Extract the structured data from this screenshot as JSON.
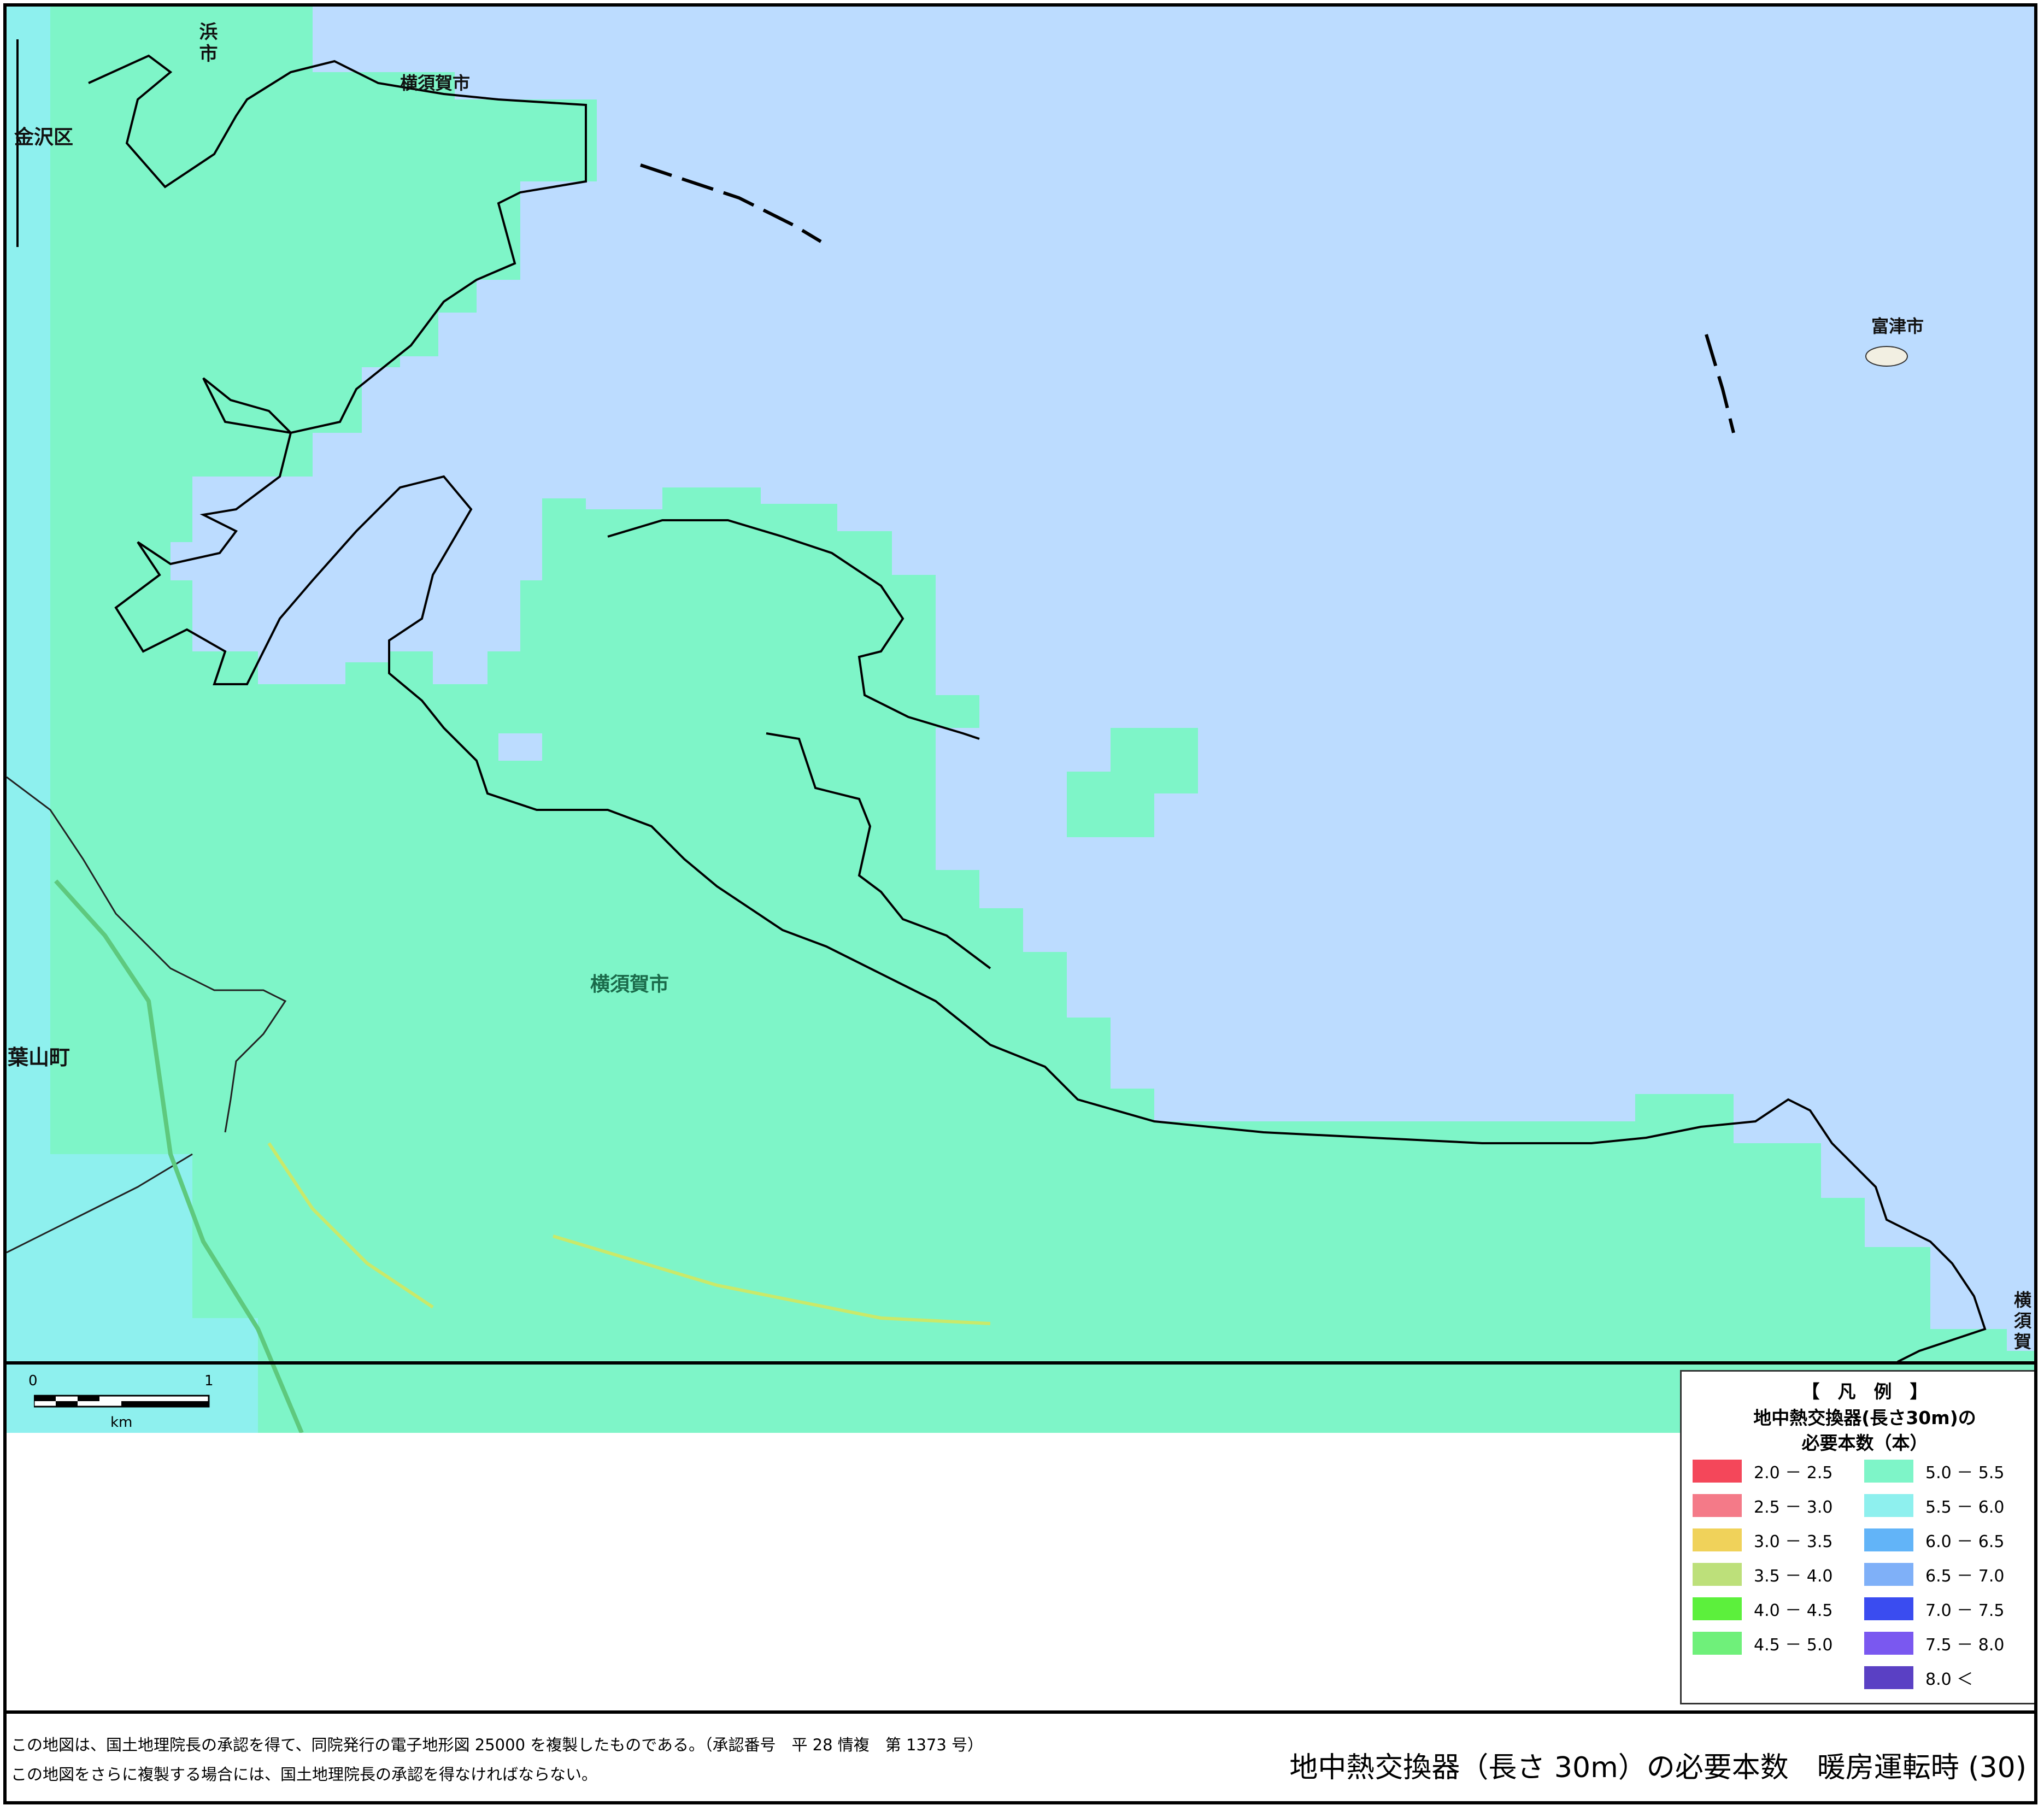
{
  "map": {
    "place_labels": {
      "top_left_city": "浜\n市",
      "kanazawa_ward": "金沢区",
      "yokosuka_top": "横須賀市",
      "futtsu_city": "富津市",
      "yokosuka_center": "横須賀市",
      "hayama_town": "葉山町",
      "yokosuka_right": "横須賀"
    },
    "colors": {
      "sea": "#bcdcff",
      "land_5_0_5_5": "#7ef5c8",
      "land_5_5_6_0": "#8ef0ee",
      "coastline": "#000000"
    }
  },
  "scale_bar": {
    "tick_start": "0",
    "tick_end": "1",
    "unit": "km"
  },
  "legend": {
    "title": "【　凡　例　】",
    "subtitle_line1": "地中熱交換器(長さ30m)の",
    "subtitle_line2": "必要本数（本）",
    "items": [
      {
        "label": "2.0 － 2.5",
        "color": "#f4475a"
      },
      {
        "label": "2.5 － 3.0",
        "color": "#f47a88"
      },
      {
        "label": "3.0 － 3.5",
        "color": "#f0d25a"
      },
      {
        "label": "3.5 － 4.0",
        "color": "#bde07a"
      },
      {
        "label": "4.0 － 4.5",
        "color": "#5cf03c"
      },
      {
        "label": "4.5 － 5.0",
        "color": "#6ff07a"
      },
      {
        "label": "5.0 － 5.5",
        "color": "#7ef5c8"
      },
      {
        "label": "5.5 － 6.0",
        "color": "#8ef0ee"
      },
      {
        "label": "6.0 － 6.5",
        "color": "#62b4f8"
      },
      {
        "label": "6.5 － 7.0",
        "color": "#7fb0f8"
      },
      {
        "label": "7.0 － 7.5",
        "color": "#3a4cf0"
      },
      {
        "label": "7.5 － 8.0",
        "color": "#7a58f0"
      },
      {
        "label": "8.0 ＜",
        "color": "#5a40c4"
      }
    ]
  },
  "footer": {
    "note_line1": "この地図は、国土地理院長の承認を得て、同院発行の電子地形図 25000 を複製したものである。（承認番号　平 28 情複　第 1373 号）",
    "note_line2": "この地図をさらに複製する場合には、国土地理院長の承認を得なければならない。",
    "map_title": "地中熱交換器（長さ 30m）の必要本数　暖房運転時 (30)"
  }
}
